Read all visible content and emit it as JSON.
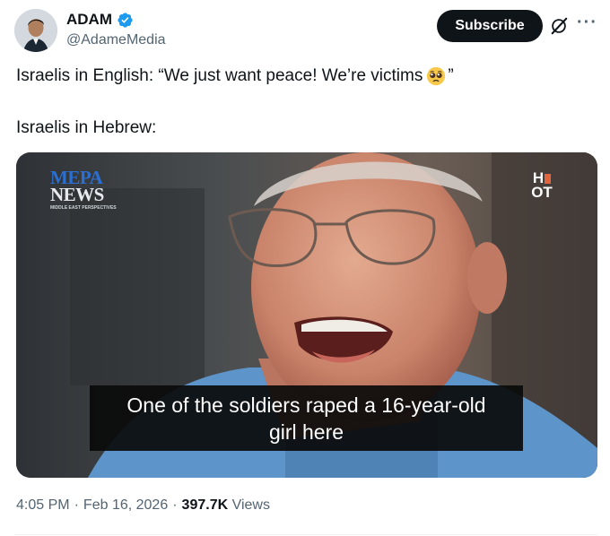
{
  "user": {
    "display_name": "ADAM",
    "handle": "@AdameMedia",
    "verified_icon": "verified-badge-icon"
  },
  "actions": {
    "subscribe_label": "Subscribe",
    "grok_icon": "grok-icon",
    "more_label": "···"
  },
  "tweet": {
    "line1_start": "Israelis in English: “We just want peace! We’re victims",
    "line1_emoji": "pleading-face-emoji",
    "line1_end": "”",
    "line2": "Israelis in Hebrew:"
  },
  "media": {
    "logo_left_line1": "MEPA",
    "logo_left_line2": "NEWS",
    "logo_left_tagline": "MIDDLE EAST PERSPECTIVES",
    "logo_right_top": "H",
    "logo_right_bottom": "OT",
    "caption_line1": "One of the soldiers raped a 16-year-old",
    "caption_line2": "girl here"
  },
  "meta": {
    "time": "4:05 PM",
    "sep1": "·",
    "date": "Feb 16, 2026",
    "sep2": "·",
    "views_count": "397.7K",
    "views_label": "Views"
  },
  "colors": {
    "text": "#0f1419",
    "secondary": "#536471",
    "verified": "#1d9bf0",
    "button_bg": "#0f1419"
  }
}
